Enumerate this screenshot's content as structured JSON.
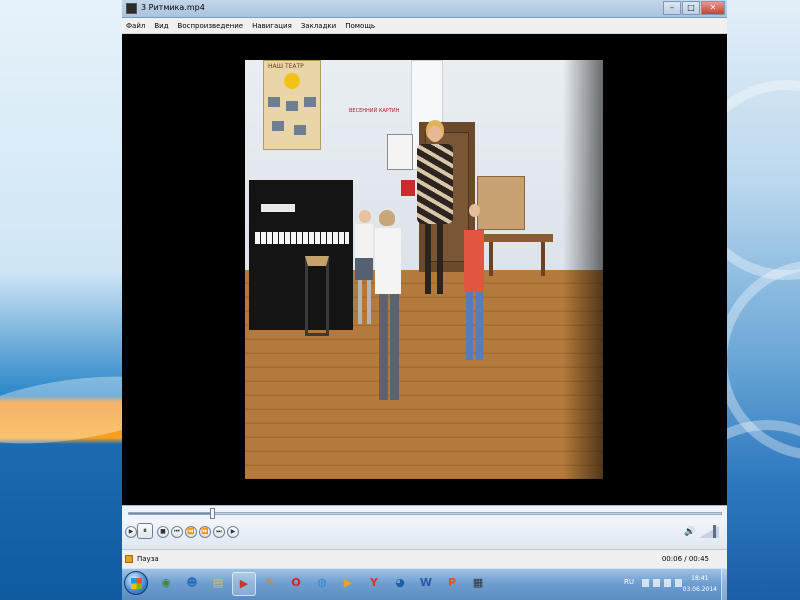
{
  "window": {
    "title": "3 Ритмика.mp4",
    "controls": {
      "minimize": "–",
      "maximize": "□",
      "close": "✕"
    }
  },
  "menu": {
    "items": [
      "Файл",
      "Вид",
      "Воспроизведение",
      "Навигация",
      "Закладки",
      "Помощь"
    ]
  },
  "video": {
    "poster_title": "НАШ ТЕАТР",
    "sign": "ВЕСЕННИЙ КАРТИН"
  },
  "player": {
    "progress_fraction": 0.14,
    "buttons": [
      {
        "name": "play-button",
        "glyph": "▶"
      },
      {
        "name": "pause-button",
        "glyph": "⏸"
      },
      {
        "name": "stop-button",
        "glyph": "■"
      },
      {
        "name": "prev-button",
        "glyph": "⏮"
      },
      {
        "name": "rewind-button",
        "glyph": "⏪"
      },
      {
        "name": "forward-button",
        "glyph": "⏩"
      },
      {
        "name": "next-button",
        "glyph": "⏭"
      },
      {
        "name": "frame-step-button",
        "glyph": "▶"
      }
    ],
    "volume_fraction": 0.8,
    "volume_icon": "🔊"
  },
  "status": {
    "state": "Пауза",
    "time": "00:06 / 00:45"
  },
  "taskbar": {
    "apps": [
      {
        "name": "chrome-taskbar-icon",
        "glyph": "◉",
        "color": "#3b8b2a"
      },
      {
        "name": "people-taskbar-icon",
        "glyph": "☻",
        "color": "#2a6fb8"
      },
      {
        "name": "notes-taskbar-icon",
        "glyph": "▤",
        "color": "#d8c04a"
      },
      {
        "name": "player-taskbar-icon",
        "glyph": "▶",
        "color": "#c23a2a"
      },
      {
        "name": "paint-taskbar-icon",
        "glyph": "✎",
        "color": "#e0802a"
      },
      {
        "name": "opera-taskbar-icon",
        "glyph": "O",
        "color": "#d9211e"
      },
      {
        "name": "browser-taskbar-icon",
        "glyph": "◍",
        "color": "#2f8ad0"
      },
      {
        "name": "media-taskbar-icon",
        "glyph": "▶",
        "color": "#e5a321"
      },
      {
        "name": "yandex-taskbar-icon",
        "glyph": "Y",
        "color": "#e23020"
      },
      {
        "name": "globe-taskbar-icon",
        "glyph": "◕",
        "color": "#1f5fa8"
      },
      {
        "name": "word-taskbar-icon",
        "glyph": "W",
        "color": "#2a5aa8"
      },
      {
        "name": "powerpoint-taskbar-icon",
        "glyph": "P",
        "color": "#d2552a"
      },
      {
        "name": "video-taskbar-icon",
        "glyph": "▦",
        "color": "#333333"
      }
    ],
    "lang": "RU",
    "clock_time": "18:41",
    "clock_date": "03.06.2014"
  }
}
